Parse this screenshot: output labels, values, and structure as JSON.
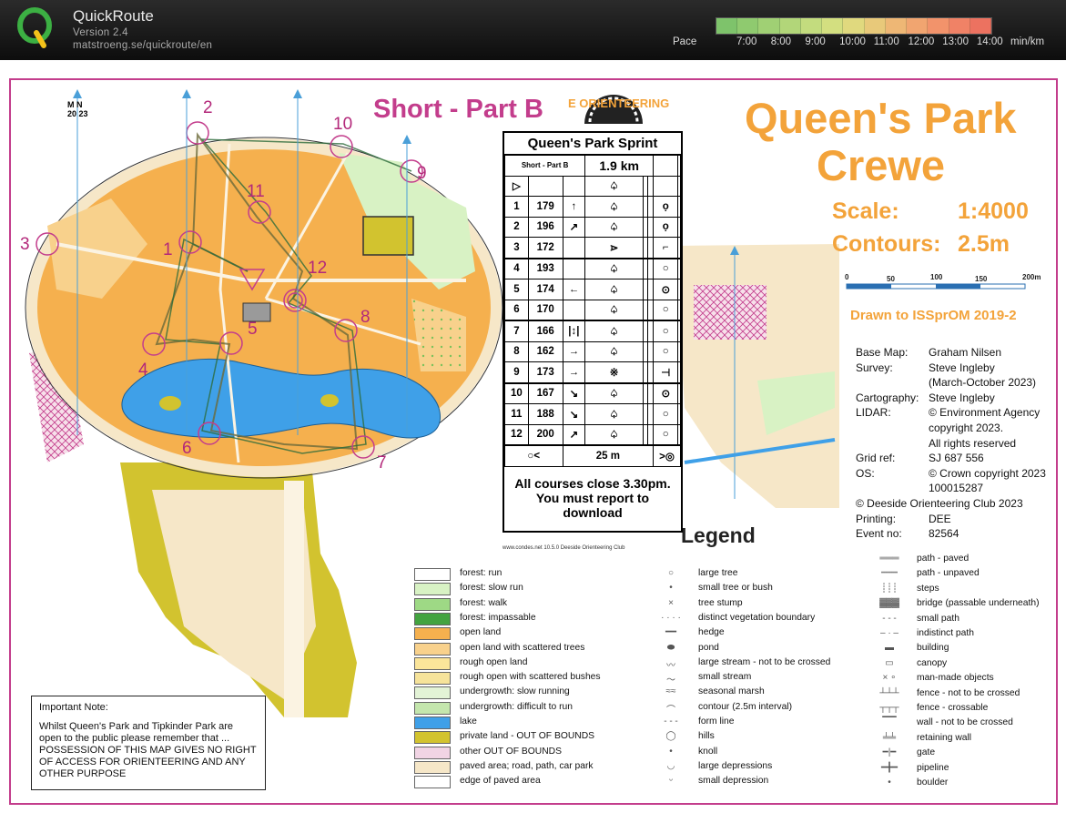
{
  "header": {
    "app_title": "QuickRoute",
    "version": "Version 2.4",
    "url": "matstroeng.se/quickroute/en",
    "pace_label": "Pace",
    "pace_ticks": [
      "7:00",
      "8:00",
      "9:00",
      "10:00",
      "11:00",
      "12:00",
      "13:00",
      "14:00"
    ],
    "pace_unit": "min/km"
  },
  "colors": {
    "frame": "#c33d8c",
    "orange_title": "#f3a33a",
    "open_land": "#f5b04e",
    "lake": "#3fa0e8",
    "private_land": "#d2c32f"
  },
  "map": {
    "course_name": "Short - Part B",
    "club_logo_text": "E ORIENTEERING",
    "title_line1": "Queen's Park",
    "title_line2": "Crewe",
    "scale_label": "Scale:",
    "scale_value": "1:4000",
    "contour_label": "Contours:",
    "contour_value": "2.5m",
    "scalebar_ticks": [
      "0",
      "50",
      "100",
      "150",
      "200m"
    ],
    "drawn_to": "Drawn to ISSprOM 2019-2",
    "north_label_1": "M N",
    "north_label_2": "20 23",
    "legend_heading": "Legend",
    "credits": [
      {
        "k": "Base Map:",
        "v": "Graham Nilsen"
      },
      {
        "k": "Survey:",
        "v": "Steve Ingleby"
      },
      {
        "k": "",
        "v": "(March-October 2023)"
      },
      {
        "k": "Cartography:",
        "v": "Steve Ingleby"
      },
      {
        "k": "LIDAR:",
        "v": "© Environment Agency"
      },
      {
        "k": "",
        "v": "copyright 2023."
      },
      {
        "k": "",
        "v": "All rights reserved"
      },
      {
        "k": "Grid ref:",
        "v": "SJ 687 556"
      },
      {
        "k": "OS:",
        "v": "© Crown copyright 2023"
      },
      {
        "k": "",
        "v": "100015287"
      },
      {
        "k": "© Deeside Orienteering Club 2023",
        "v": ""
      },
      {
        "k": "Printing:",
        "v": "DEE"
      },
      {
        "k": "Event no:",
        "v": "82564"
      }
    ],
    "control_numbers": [
      "1",
      "2",
      "3",
      "4",
      "5",
      "6",
      "7",
      "8",
      "9",
      "10",
      "11",
      "12"
    ]
  },
  "control_card": {
    "title": "Queen's Park Sprint",
    "class": "Short - Part B",
    "length": "1.9 km",
    "rows": [
      {
        "n": "1",
        "code": "179",
        "c": "↑",
        "d": "♤",
        "g": "ọ"
      },
      {
        "n": "2",
        "code": "196",
        "c": "↗",
        "d": "♤",
        "g": "ọ"
      },
      {
        "n": "3",
        "code": "172",
        "c": "",
        "d": "⋗",
        "g": "⌐"
      },
      {
        "n": "4",
        "code": "193",
        "c": "",
        "d": "♤",
        "g": "○"
      },
      {
        "n": "5",
        "code": "174",
        "c": "←",
        "d": "♤",
        "g": "⊙"
      },
      {
        "n": "6",
        "code": "170",
        "c": "",
        "d": "♤",
        "g": "○"
      },
      {
        "n": "7",
        "code": "166",
        "c": "|↕|",
        "d": "♤",
        "g": "○"
      },
      {
        "n": "8",
        "code": "162",
        "c": "→",
        "d": "♤",
        "g": "○"
      },
      {
        "n": "9",
        "code": "173",
        "c": "→",
        "d": "※",
        "g": "⊣"
      },
      {
        "n": "10",
        "code": "167",
        "c": "↘",
        "d": "♤",
        "g": "⊙"
      },
      {
        "n": "11",
        "code": "188",
        "c": "↘",
        "d": "♤",
        "g": "○"
      },
      {
        "n": "12",
        "code": "200",
        "c": "↗",
        "d": "♤",
        "g": "○"
      }
    ],
    "finish_distance": "25 m",
    "footer": "All courses close 3.30pm. You must report to download",
    "credit": "www.condes.net 10.5.0 Deeside Orienteering Club"
  },
  "important_note": {
    "heading": "Important Note:",
    "line1": "Whilst Queen's Park and Tipkinder Park are open to the public please remember that ...",
    "line2": "POSSESSION OF THIS MAP GIVES NO RIGHT OF ACCESS FOR ORIENTEERING AND ANY OTHER PURPOSE"
  },
  "legend_col1": [
    {
      "label": "forest: run",
      "color": "#ffffff"
    },
    {
      "label": "forest: slow run",
      "color": "#d8f2c4"
    },
    {
      "label": "forest: walk",
      "color": "#9ed985"
    },
    {
      "label": "forest: impassable",
      "color": "#43a340"
    },
    {
      "label": "open land",
      "color": "#f5b04e"
    },
    {
      "label": "open land with scattered trees",
      "color": "#f8d18c"
    },
    {
      "label": "rough open land",
      "color": "#fbe59a"
    },
    {
      "label": "rough open with scattered bushes",
      "color": "#f6e39a"
    },
    {
      "label": "undergrowth: slow running",
      "color": "#e3f3d6"
    },
    {
      "label": "undergrowth: difficult to run",
      "color": "#c4e6ad"
    },
    {
      "label": "lake",
      "color": "#3fa0e8"
    },
    {
      "label": "private land - OUT OF BOUNDS",
      "color": "#d2c32f"
    },
    {
      "label": "other OUT OF BOUNDS",
      "color": "#f1d4e4"
    },
    {
      "label": "paved area; road, path, car park",
      "color": "#f6e7c8"
    },
    {
      "label": "edge of paved area",
      "color": "#ffffff"
    }
  ],
  "legend_col2": [
    {
      "label": "large tree",
      "sym": "○"
    },
    {
      "label": "small tree or bush",
      "sym": "•"
    },
    {
      "label": "tree stump",
      "sym": "×"
    },
    {
      "label": "distinct vegetation boundary",
      "sym": "· · · ·"
    },
    {
      "label": "hedge",
      "sym": "━━"
    },
    {
      "label": "pond",
      "sym": "⬬"
    },
    {
      "label": "large stream - not to be crossed",
      "sym": "〰"
    },
    {
      "label": "small stream",
      "sym": "～"
    },
    {
      "label": "seasonal marsh",
      "sym": "≈≈"
    },
    {
      "label": "contour (2.5m interval)",
      "sym": "⌒"
    },
    {
      "label": "form line",
      "sym": "- - -"
    },
    {
      "label": "hills",
      "sym": "◯"
    },
    {
      "label": "knoll",
      "sym": "•"
    },
    {
      "label": "large depressions",
      "sym": "◡"
    },
    {
      "label": "small depression",
      "sym": "ᵕ"
    }
  ],
  "legend_col3": [
    {
      "label": "path - paved",
      "sym": "═══"
    },
    {
      "label": "path - unpaved",
      "sym": "┅┅┅"
    },
    {
      "label": "steps",
      "sym": "┊┊┊"
    },
    {
      "label": "bridge (passable underneath)",
      "sym": "▓▓▓"
    },
    {
      "label": "small path",
      "sym": "- - -"
    },
    {
      "label": "indistinct path",
      "sym": "– · –"
    },
    {
      "label": "building",
      "sym": "▬"
    },
    {
      "label": "canopy",
      "sym": "▭"
    },
    {
      "label": "man-made objects",
      "sym": "× ∘"
    },
    {
      "label": "fence - not to be crossed",
      "sym": "┴┴┴"
    },
    {
      "label": "fence - crossable",
      "sym": "┬┬┬"
    },
    {
      "label": "wall - not to be crossed",
      "sym": "▔▔"
    },
    {
      "label": "retaining wall",
      "sym": "╧╧"
    },
    {
      "label": "gate",
      "sym": "━|━"
    },
    {
      "label": "pipeline",
      "sym": "━╋━"
    },
    {
      "label": "boulder",
      "sym": "•"
    }
  ]
}
